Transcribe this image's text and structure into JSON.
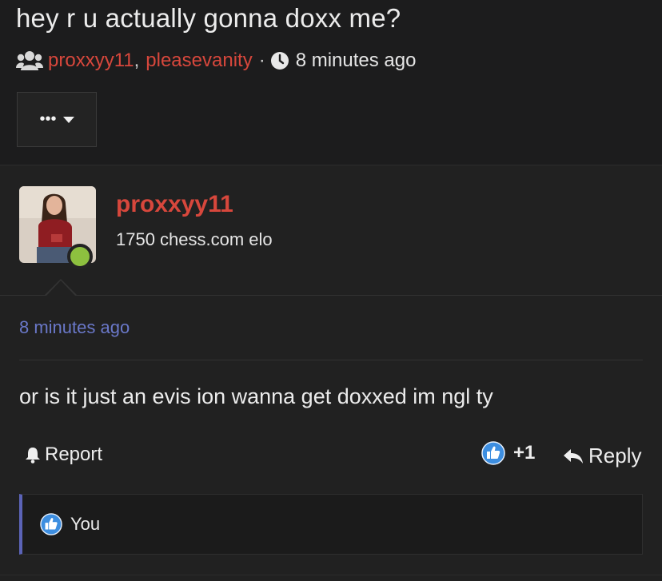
{
  "thread": {
    "title": "hey r u actually gonna doxx me?",
    "participants": [
      "proxxyy11",
      "pleasevanity"
    ],
    "participants_separator": ",",
    "dot_separator": "·",
    "time": "8 minutes ago",
    "more_label": "•••"
  },
  "post": {
    "username": "proxxyy11",
    "user_title": "1750 chess.com elo",
    "online": true,
    "time": "8 minutes ago",
    "message": "or is it just an evis ion wanna get doxxed im ngl ty",
    "report_label": "Report",
    "like_count": "+1",
    "reply_label": "Reply",
    "liked_by": "You"
  },
  "colors": {
    "username": "#d7473c",
    "link_time": "#6a78c9",
    "online": "#8dc03f",
    "like_blue": "#3d8ee0"
  }
}
